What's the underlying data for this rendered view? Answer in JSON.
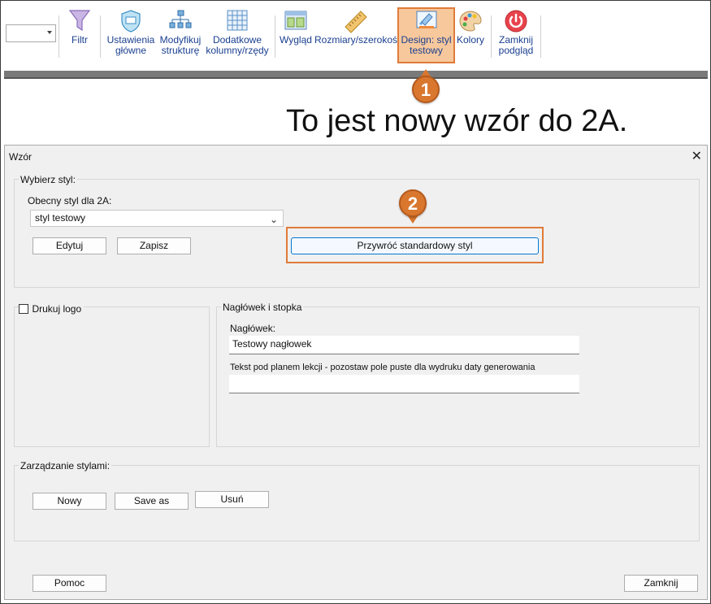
{
  "ribbon": {
    "buttons": [
      {
        "id": "filtr",
        "label1": "Filtr",
        "label2": "",
        "icon": "funnel-icon"
      },
      {
        "id": "ustawienia",
        "label1": "Ustawienia",
        "label2": "główne",
        "icon": "shield-settings-icon"
      },
      {
        "id": "modyfikuj",
        "label1": "Modyfikuj",
        "label2": "strukturę",
        "icon": "hierarchy-icon"
      },
      {
        "id": "dodatkowe",
        "label1": "Dodatkowe",
        "label2": "kolumny/rzędy",
        "icon": "grid-icon"
      },
      {
        "id": "wyglad",
        "label1": "Wygląd",
        "label2": "",
        "icon": "layout-icon"
      },
      {
        "id": "rozmiary",
        "label1": "Rozmiary/szerokości",
        "label2": "",
        "icon": "ruler-icon"
      },
      {
        "id": "design",
        "label1": "Design: styl",
        "label2": "testowy",
        "icon": "design-brush-icon"
      },
      {
        "id": "kolory",
        "label1": "Kolory",
        "label2": "",
        "icon": "palette-icon"
      },
      {
        "id": "zamknij",
        "label1": "Zamknij",
        "label2": "podgląd",
        "icon": "power-icon"
      }
    ],
    "accent": "#e07b39"
  },
  "headline": "To jest nowy wzór do 2A.",
  "steps": {
    "one": "1",
    "two": "2"
  },
  "dialog": {
    "title": "Wzór",
    "close_glyph": "✕",
    "style_group": {
      "label": "Wybierz styl:",
      "current_label": "Obecny styl dla 2A:",
      "current_value": "styl testowy",
      "edit_button": "Edytuj",
      "save_button": "Zapisz",
      "restore_button": "Przywróć standardowy styl"
    },
    "print_logo_label": "Drukuj logo",
    "header_footer": {
      "label": "Nagłówek i stopka",
      "header_label": "Nagłówek:",
      "header_value": "Testowy nagłowek",
      "footer_label": "Tekst pod planem lekcji - pozostaw pole puste dla wydruku daty generowania",
      "footer_value": ""
    },
    "manage": {
      "label": "Zarządzanie stylami:",
      "new_button": "Nowy",
      "save_as_button": "Save as",
      "delete_button": "Usuń"
    },
    "help_button": "Pomoc",
    "close_button": "Zamknij"
  }
}
